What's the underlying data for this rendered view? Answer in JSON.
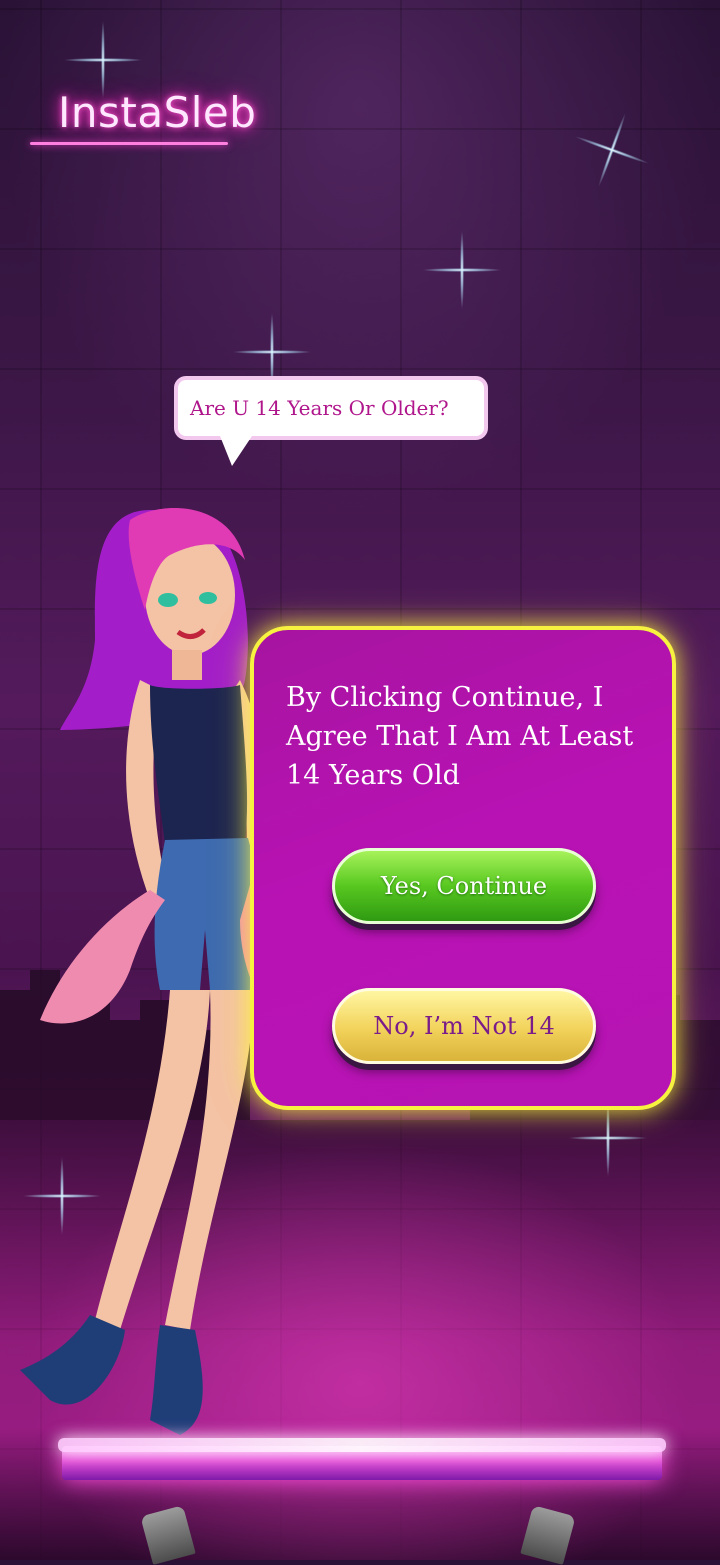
{
  "app": {
    "logo": "InstaSleb"
  },
  "speech_bubble": {
    "text": "Are U 14 Years Or Older?"
  },
  "age_panel": {
    "message": "By Clicking Continue, I Agree That I Am At Least 14 Years Old",
    "yes_label": "Yes, Continue",
    "no_label": "No, I’m Not 14"
  },
  "colors": {
    "panel_bg": "#b812b4",
    "panel_border": "#f7f240",
    "yes_button": "#58c820",
    "no_button": "#f2d25a",
    "no_button_text": "#7a1c8a",
    "bubble_text": "#b0168c"
  },
  "icons": [
    "sparkle-icon",
    "stage-lamp-icon"
  ]
}
